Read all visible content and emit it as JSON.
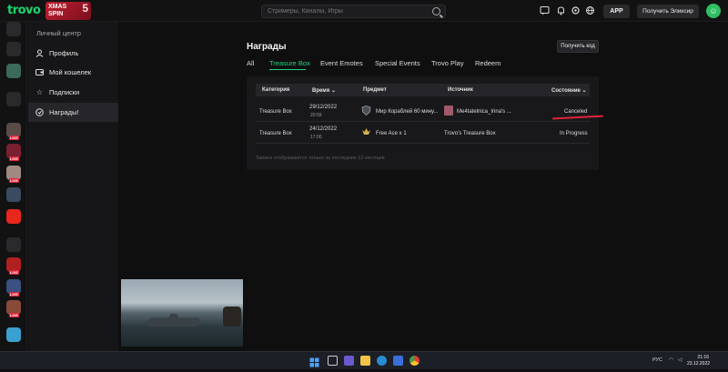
{
  "topbar": {
    "logo": "trovo",
    "promo_line1": "XMAS",
    "promo_line2": "SPIN",
    "promo_badge": "5",
    "search_placeholder": "Стримеры, Каналы, Игры",
    "app_label": "APP",
    "elixir_label": "Получить Эликсир"
  },
  "sidemenu": {
    "title": "Личный центр",
    "items": [
      {
        "label": "Профиль",
        "icon": "user-icon"
      },
      {
        "label": "Мой кошелек",
        "icon": "wallet-icon"
      },
      {
        "label": "Подписки",
        "icon": "star-icon"
      },
      {
        "label": "Награды!",
        "icon": "gift-icon"
      }
    ]
  },
  "rail": {
    "live_label": "LIVE"
  },
  "main": {
    "title": "Награды",
    "get_code_label": "Получить код",
    "tabs": [
      {
        "label": "All"
      },
      {
        "label": "Treasure Box"
      },
      {
        "label": "Event Emotes"
      },
      {
        "label": "Special Events"
      },
      {
        "label": "Trovo Play"
      },
      {
        "label": "Redeem"
      }
    ],
    "table": {
      "headers": [
        "Категория",
        "Время",
        "Предмет",
        "Источник",
        "Состояние"
      ],
      "rows": [
        {
          "category": "Treasure Box",
          "date": "29/12/2022",
          "time": "20:59",
          "item": "Мир Кораблей 60 мину...",
          "source": "Me4tatelnica_Irina's ...",
          "status": "Canceled"
        },
        {
          "category": "Treasure Box",
          "date": "24/12/2022",
          "time": "17:00",
          "item": "Free Ace x 1",
          "source": "Trovo's Treasure Box",
          "status": "In Progress"
        }
      ],
      "footnote": "Записи отображаются только за последние 12 месяцев"
    }
  },
  "taskbar": {
    "lang": "РУС",
    "time": "21:16",
    "date": "23.12.2022"
  },
  "colors": {
    "accent": "#1fd47c",
    "brand": "#19d66b",
    "mark": "#e0243a"
  }
}
